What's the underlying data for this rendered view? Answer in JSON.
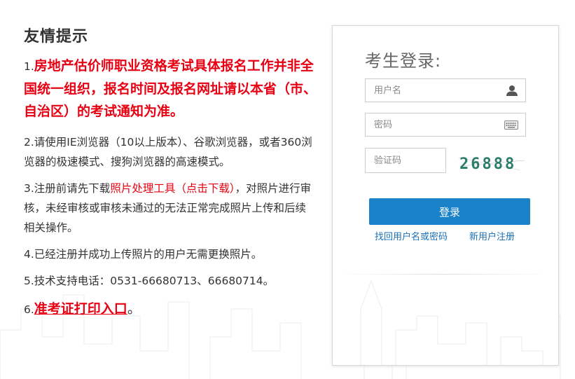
{
  "notice": {
    "title": "友情提示",
    "item1": {
      "num": "1.",
      "text": "房地产估价师职业资格考试具体报名工作并非全国统一组织，报名时间及报名网址请以本省（市、自治区）的考试通知为准。"
    },
    "item2": {
      "num": "2.",
      "text": "请使用IE浏览器（10以上版本）、谷歌浏览器，或者360浏览器的极速模式、搜狗浏览器的高速模式。"
    },
    "item3": {
      "num": "3.",
      "pre": "注册前请先下载",
      "link": "照片处理工具（点击下载）",
      "post": "，对照片进行审核，未经审核或审核未通过的无法正常完成照片上传和后续相关操作。"
    },
    "item4": {
      "num": "4.",
      "text": "已经注册并成功上传照片的用户无需更换照片。"
    },
    "item5": {
      "num": "5.",
      "text": "技术支持电话：0531-66680713、66680714。"
    },
    "item6": {
      "num": "6.",
      "link": "准考证打印入口",
      "tail": "。"
    }
  },
  "login": {
    "title": "考生登录:",
    "username_placeholder": "用户名",
    "password_placeholder": "密码",
    "captcha_placeholder": "验证码",
    "captcha_text": "26888",
    "submit_label": "登录",
    "forgot_link": "找回用户名或密码",
    "register_link": "新用户注册"
  },
  "colors": {
    "accent_red": "#e60012",
    "button_blue": "#1a82c8",
    "link_blue": "#1a6fb4"
  },
  "icons": {
    "username": "user-icon",
    "password": "keyboard-icon"
  }
}
